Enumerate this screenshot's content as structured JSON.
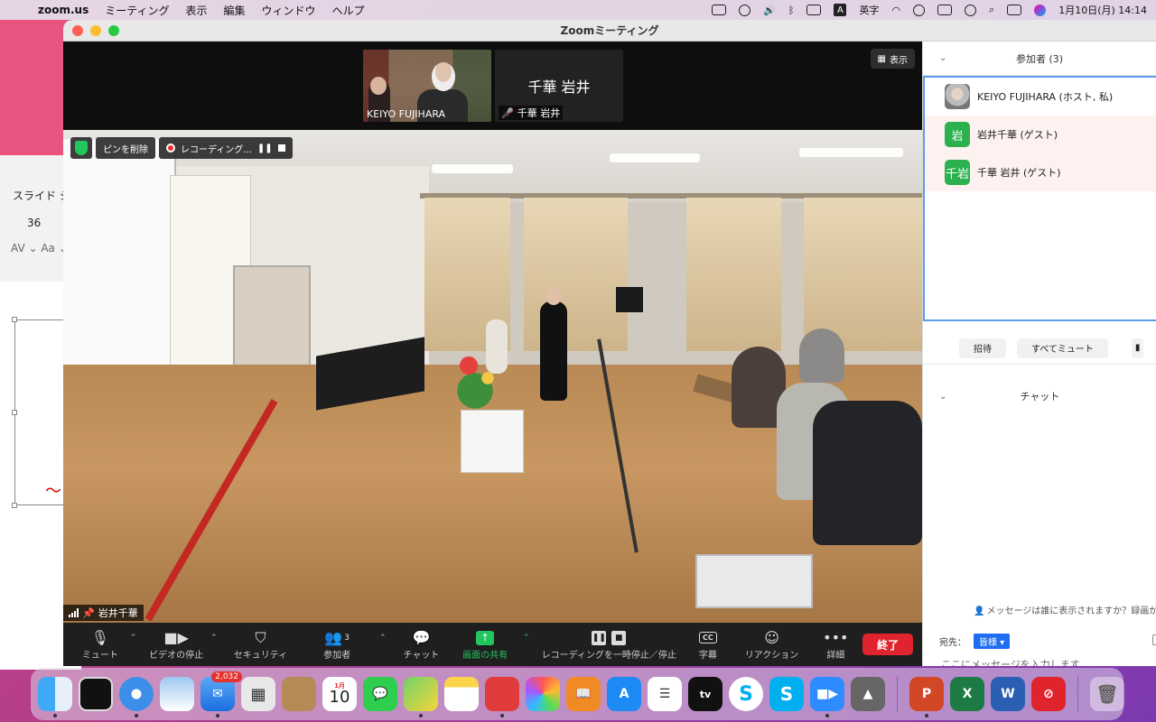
{
  "menubar": {
    "app_name": "zoom.us",
    "menus": [
      "ミーティング",
      "表示",
      "編集",
      "ウィンドウ",
      "ヘルプ"
    ],
    "input_mode": "英字",
    "datetime": "1月10日(月)  14:14",
    "ime_letter": "A"
  },
  "bg_app": {
    "slide_label": "スライド シ",
    "font_size": "36",
    "spacing_label": "AV",
    "case_label": "Aa"
  },
  "window": {
    "title": "Zoomミーティング"
  },
  "video": {
    "view_button": "表示",
    "thumbnails": [
      {
        "name": "KEIYO FUJIHARA"
      },
      {
        "name": "千華 岩井",
        "center_name": "千華 岩井"
      }
    ],
    "pills": {
      "unpin": "ピンを削除",
      "recording": "レコーディング..."
    },
    "speaker_name": "岩井千華"
  },
  "controls": {
    "mute": "ミュート",
    "video_stop": "ビデオの停止",
    "security": "セキュリティ",
    "participants": "参加者",
    "participant_count": "3",
    "chat": "チャット",
    "share": "画面の共有",
    "recording": "レコーディングを一時停止／停止",
    "captions": "字幕",
    "captions_icon": "CC",
    "reactions": "リアクション",
    "more": "詳細",
    "end": "終了"
  },
  "participants_panel": {
    "title": "参加者 (3)",
    "list": [
      {
        "name": "KEIYO FUJIHARA (ホスト, 私)",
        "avatar": ""
      },
      {
        "name": "岩井千華 (ゲスト)",
        "avatar": "岩"
      },
      {
        "name": "千華 岩井 (ゲスト)",
        "avatar": "千岩"
      }
    ],
    "invite": "招待",
    "mute_all": "すべてミュート"
  },
  "chat_panel": {
    "title": "チャット",
    "notice": "メッセージは誰に表示されますか？録画が",
    "to_label": "宛先：",
    "to_value": "皆様",
    "placeholder": "ここにメッセージを入力します..."
  },
  "dock": {
    "mail_badge": "2,032",
    "calendar_month": "1月",
    "calendar_day": "10",
    "tv_label": "tv"
  },
  "colors": {
    "zoom_green": "#22c55e",
    "end_red": "#e0242d",
    "selection_blue": "#5b9cf0"
  }
}
